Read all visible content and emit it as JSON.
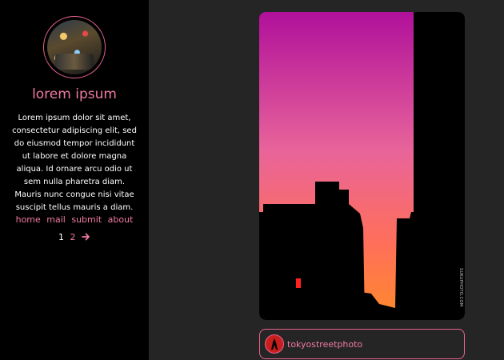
{
  "sidebar": {
    "avatar_icon": "profile-photo-city-night",
    "title": "lorem ipsum",
    "description": "Lorem ipsum dolor sit amet, consectetur adipiscing elit, sed do eiusmod tempor incididunt ut labore et dolore magna aliqua. Id ornare arcu odio ut sem nulla pharetra diam. Mauris nunc congue nisi vitae suscipit tellus mauris a diam.",
    "nav": [
      {
        "label": "home"
      },
      {
        "label": "mail"
      },
      {
        "label": "submit"
      },
      {
        "label": "about"
      }
    ],
    "pagination": {
      "current": "1",
      "next_page": "2",
      "next_icon": "arrow-right-icon"
    }
  },
  "post": {
    "photo_icon": "sunset-city-silhouette",
    "watermark": "SUKUPHOTO.COM",
    "source": {
      "name": "tokyostreetphoto",
      "avatar_icon": "tokyo-tower-icon"
    }
  },
  "colors": {
    "accent": "#ef7aa0",
    "sidebar_bg": "#000000",
    "page_bg": "#252525",
    "sky_top": "#b0109a",
    "sky_mid": "#e8649a",
    "sky_bottom": "#ff8a2a"
  }
}
